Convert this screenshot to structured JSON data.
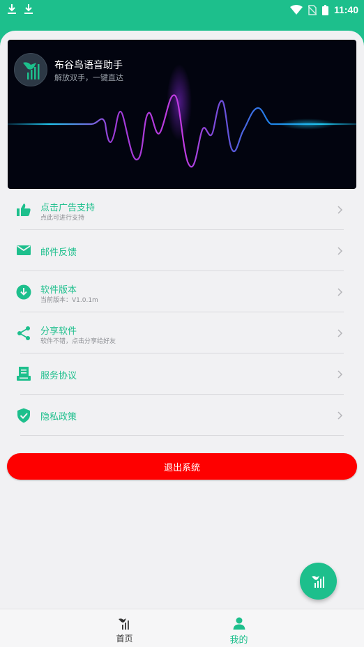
{
  "status_bar": {
    "time": "11:40"
  },
  "banner": {
    "app_name": "布谷鸟语音助手",
    "slogan": "解放双手，一键直达"
  },
  "menu": [
    {
      "title": "点击广告支持",
      "subtitle": "点此可进行支持",
      "icon": "thumbs-up-icon"
    },
    {
      "title": "邮件反馈",
      "subtitle": "",
      "icon": "mail-icon"
    },
    {
      "title": "软件版本",
      "subtitle": "当前版本：V1.0.1m",
      "icon": "download-icon"
    },
    {
      "title": "分享软件",
      "subtitle": "软件不错，点击分享给好友",
      "icon": "share-icon"
    },
    {
      "title": "服务协议",
      "subtitle": "",
      "icon": "agreement-icon"
    },
    {
      "title": "隐私政策",
      "subtitle": "",
      "icon": "shield-check-icon"
    }
  ],
  "logout_label": "退出系统",
  "nav": {
    "home_label": "首页",
    "mine_label": "我的"
  },
  "colors": {
    "accent": "#1dbf8c",
    "logout": "#fe0000",
    "banner_bg": "#02040f"
  }
}
